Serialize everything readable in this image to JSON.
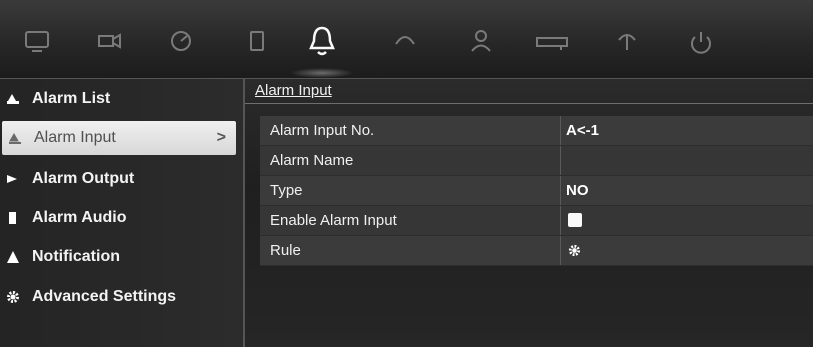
{
  "toolbar": {
    "icons": [
      {
        "name": "display-icon"
      },
      {
        "name": "camera-icon"
      },
      {
        "name": "record-icon"
      },
      {
        "name": "storage-icon"
      },
      {
        "name": "alarm-bell-icon",
        "active": true
      },
      {
        "name": "network-icon"
      },
      {
        "name": "user-icon"
      },
      {
        "name": "device-icon"
      },
      {
        "name": "system-info-icon"
      },
      {
        "name": "shutdown-icon"
      }
    ]
  },
  "sidebar": {
    "items": [
      {
        "label": "Alarm List",
        "icon": "alarm-list-icon"
      },
      {
        "label": "Alarm Input",
        "icon": "alarm-input-icon",
        "selected": true,
        "chevron": ">"
      },
      {
        "label": "Alarm Output",
        "icon": "alarm-output-icon"
      },
      {
        "label": "Alarm Audio",
        "icon": "alarm-audio-icon"
      },
      {
        "label": "Notification",
        "icon": "warning-icon"
      },
      {
        "label": "Advanced Settings",
        "icon": "gear-icon"
      }
    ]
  },
  "main": {
    "heading": "Alarm Input",
    "rows": [
      {
        "label": "Alarm Input No.",
        "value": "A<-1"
      },
      {
        "label": "Alarm Name",
        "value": ""
      },
      {
        "label": "Type",
        "value": "NO"
      },
      {
        "label": "Enable Alarm Input",
        "checked": true
      },
      {
        "label": "Rule",
        "value_icon": "gear-icon"
      }
    ]
  }
}
